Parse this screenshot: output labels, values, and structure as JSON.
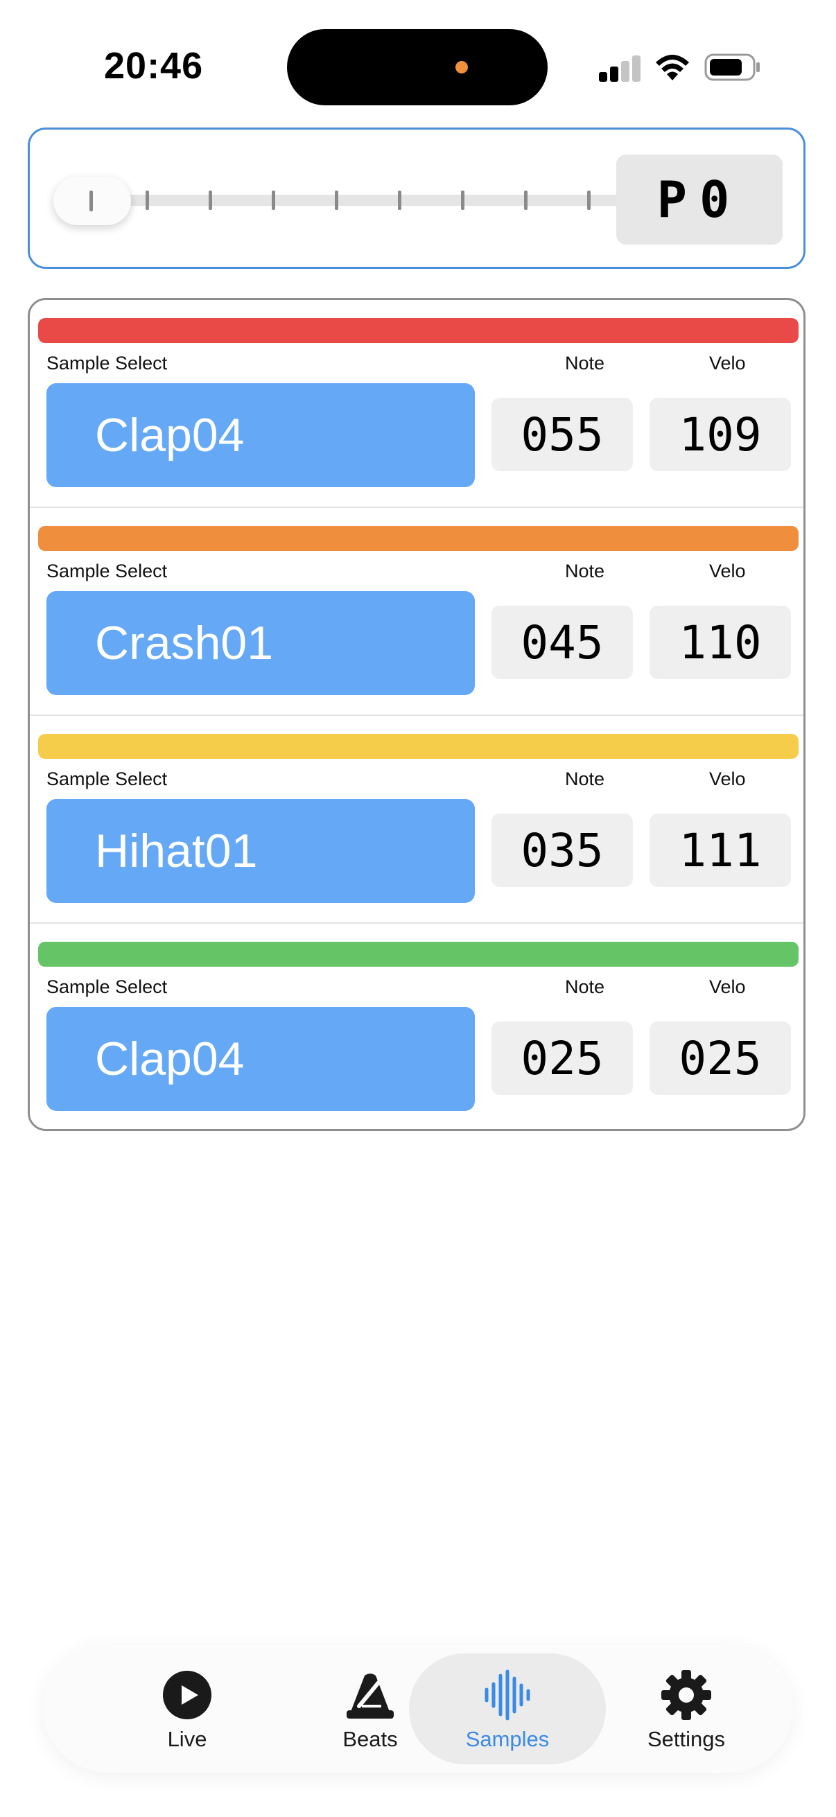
{
  "status_bar": {
    "time": "20:46",
    "signal_icon": "cellular-signal-icon",
    "wifi_icon": "wifi-icon",
    "battery_icon": "battery-icon"
  },
  "control_panel": {
    "pattern_label": "P0",
    "slider_steps": 10,
    "slider_selected_step": 1
  },
  "labels": {
    "sample_select": "Sample Select",
    "note": "Note",
    "velo": "Velo"
  },
  "samples": [
    {
      "color": "#e94a47",
      "name": "Clap04",
      "note": "055",
      "velo": "109"
    },
    {
      "color": "#ef8f3e",
      "name": "Crash01",
      "note": "045",
      "velo": "110"
    },
    {
      "color": "#f6cd4a",
      "name": "Hihat01",
      "note": "035",
      "velo": "111"
    },
    {
      "color": "#65c466",
      "name": "Clap04",
      "note": "025",
      "velo": "025"
    }
  ],
  "tabs": [
    {
      "label": "Live",
      "icon": "play-circle-icon",
      "active": false
    },
    {
      "label": "Beats",
      "icon": "metronome-icon",
      "active": false
    },
    {
      "label": "Samples",
      "icon": "waveform-icon",
      "active": true
    },
    {
      "label": "Settings",
      "icon": "gear-icon",
      "active": false
    }
  ],
  "colors": {
    "accent": "#3a8ae6",
    "sample_button": "#64a8f6",
    "panel_border": "#4a8fdb"
  }
}
